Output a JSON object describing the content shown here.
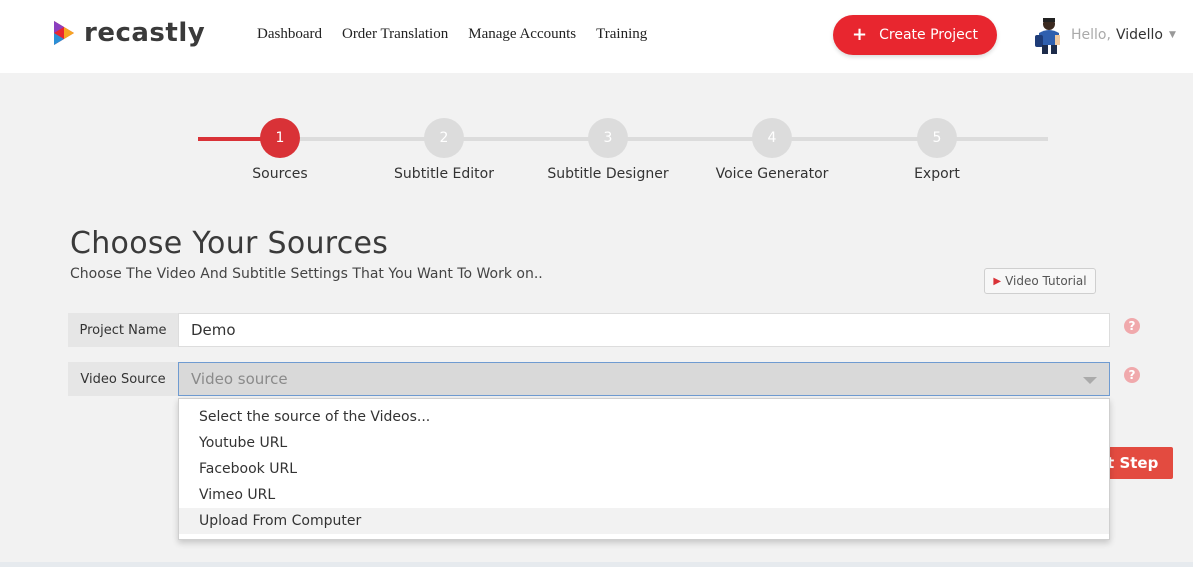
{
  "brand": {
    "name": "recastly",
    "accent_color": "#e8262f",
    "logo_icon": "play-triangle-logo-icon"
  },
  "nav": {
    "items": [
      {
        "label": "Dashboard"
      },
      {
        "label": "Order Translation"
      },
      {
        "label": "Manage Accounts"
      },
      {
        "label": "Training"
      }
    ]
  },
  "header": {
    "create_label": "Create Project",
    "greeting": "Hello,",
    "username": "Vidello"
  },
  "steps": [
    {
      "number": "1",
      "label": "Sources",
      "active": true
    },
    {
      "number": "2",
      "label": "Subtitle Editor",
      "active": false
    },
    {
      "number": "3",
      "label": "Subtitle Designer",
      "active": false
    },
    {
      "number": "4",
      "label": "Voice Generator",
      "active": false
    },
    {
      "number": "5",
      "label": "Export",
      "active": false
    }
  ],
  "page": {
    "title": "Choose Your Sources",
    "subtitle": "Choose The Video And Subtitle Settings That You Want To Work on..",
    "tutorial_label": "Video Tutorial"
  },
  "form": {
    "project_name_label": "Project Name",
    "project_name_value": "Demo",
    "video_source_label": "Video Source",
    "video_source_placeholder": "Video source",
    "help_icon": "?",
    "next_label": "Next Step",
    "next_label_visible": "xt Step"
  },
  "dropdown": {
    "options": [
      "Select the source of the Videos...",
      "Youtube URL",
      "Facebook URL",
      "Vimeo URL",
      "Upload From Computer"
    ],
    "hovered_index": 4
  }
}
